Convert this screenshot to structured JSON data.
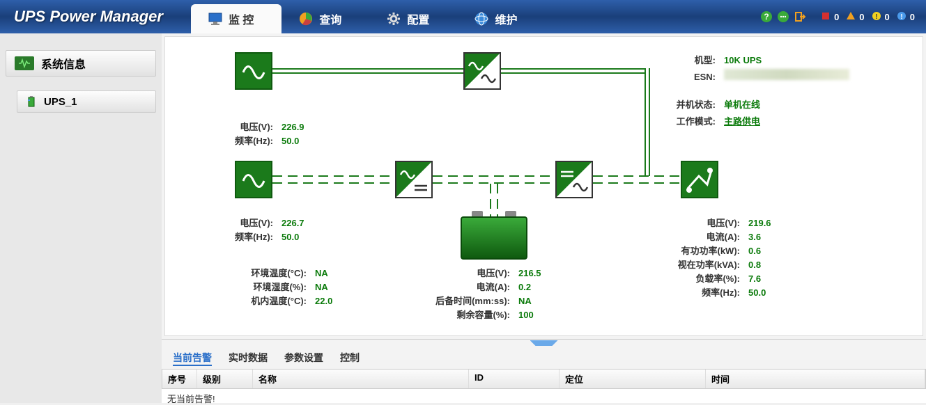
{
  "app_title": "UPS Power Manager",
  "nav": {
    "monitor": "监 控",
    "query": "查询",
    "config": "配置",
    "maint": "维护"
  },
  "alarms": {
    "critical": "0",
    "major": "0",
    "minor": "0",
    "info": "0"
  },
  "sidebar": {
    "header": "系统信息",
    "device": "UPS_1"
  },
  "info": {
    "model_label": "机型:",
    "model_value": "10K UPS",
    "esn_label": "ESN:",
    "parallel_label": "并机状态:",
    "parallel_value": "单机在线",
    "mode_label": "工作模式:",
    "mode_value": "主路供电"
  },
  "bypass": {
    "voltage_l": "电压(V):",
    "voltage_v": "226.9",
    "freq_l": "频率(Hz):",
    "freq_v": "50.0"
  },
  "input": {
    "voltage_l": "电压(V):",
    "voltage_v": "226.7",
    "freq_l": "频率(Hz):",
    "freq_v": "50.0"
  },
  "env": {
    "temp_l": "环境温度(°C):",
    "temp_v": "NA",
    "hum_l": "环境湿度(%):",
    "hum_v": "NA",
    "inttemp_l": "机内温度(°C):",
    "inttemp_v": "22.0"
  },
  "battery": {
    "voltage_l": "电压(V):",
    "voltage_v": "216.5",
    "current_l": "电流(A):",
    "current_v": "0.2",
    "backup_l": "后备时间(mm:ss):",
    "backup_v": "NA",
    "remain_l": "剩余容量(%):",
    "remain_v": "100"
  },
  "output": {
    "voltage_l": "电压(V):",
    "voltage_v": "219.6",
    "current_l": "电流(A):",
    "current_v": "3.6",
    "kw_l": "有功功率(kW):",
    "kw_v": "0.6",
    "kva_l": "视在功率(kVA):",
    "kva_v": "0.8",
    "load_l": "负载率(%):",
    "load_v": "7.6",
    "freq_l": "频率(Hz):",
    "freq_v": "50.0"
  },
  "btabs": {
    "alarm": "当前告警",
    "realtime": "实时数据",
    "params": "参数设置",
    "control": "控制"
  },
  "bcols": {
    "seq": "序号",
    "level": "级别",
    "name": "名称",
    "id": "ID",
    "loc": "定位",
    "time": "时间"
  },
  "empty_msg": "无当前告警!"
}
